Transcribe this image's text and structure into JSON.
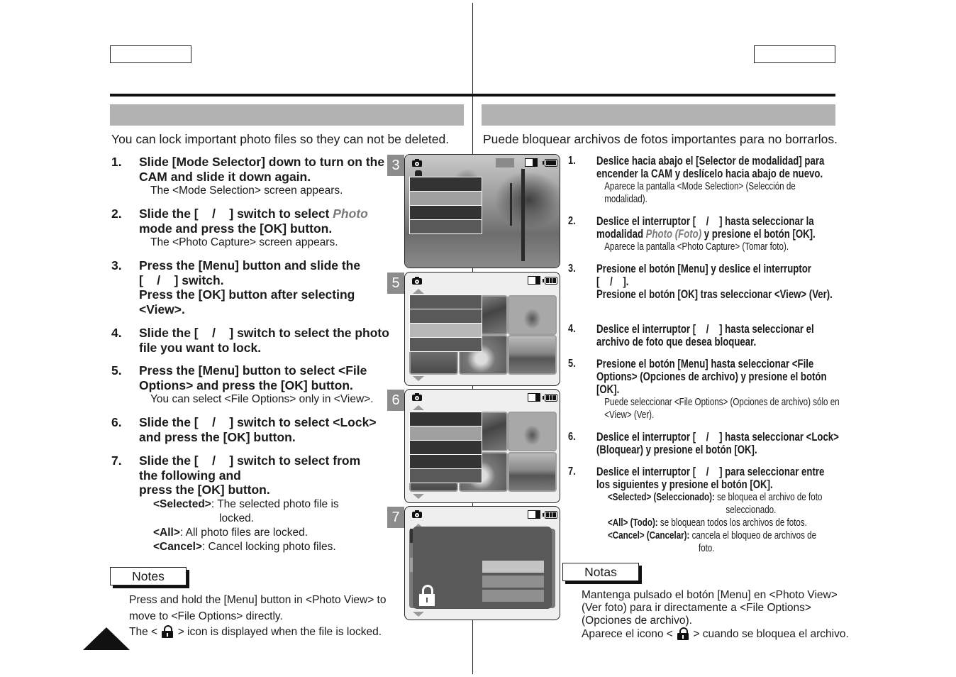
{
  "header": {
    "left_lang_box": "",
    "right_lang_box": ""
  },
  "english": {
    "title": "",
    "intro": "You can lock important photo files so they can not be deleted.",
    "steps": [
      {
        "num": "1.",
        "text": "Slide [Mode Selector] down to turn on the CAM and slide it down again.",
        "sub": "The <Mode Selection> screen appears."
      },
      {
        "num": "2.",
        "text_pre": "Slide the [    /    ] switch to select ",
        "text_em": "Photo",
        "text_post": " mode and press the [OK] button.",
        "sub": "The <Photo Capture> screen appears."
      },
      {
        "num": "3.",
        "line1": "Press the [Menu] button and slide the",
        "line2": "[    /    ] switch.",
        "line3": "Press the [OK] button after selecting <View>."
      },
      {
        "num": "4.",
        "text": "Slide the [    /    ] switch to select the photo file you want to lock."
      },
      {
        "num": "5.",
        "text": "Press the [Menu] button to select <File Options> and press the [OK] button.",
        "sub": "You can select <File Options> only in <View>."
      },
      {
        "num": "6.",
        "text": "Slide the [    /    ] switch to select <Lock> and press the [OK] button."
      },
      {
        "num": "7.",
        "line1": "Slide the [    /    ] switch to select from",
        "line2": "the following and",
        "line3": "press the [OK] button.",
        "options": [
          {
            "key": "<Selected>",
            "desc": ": The selected photo file is",
            "desc2": "locked."
          },
          {
            "key": "<All>",
            "desc": ": All photo files are locked."
          },
          {
            "key": "<Cancel>",
            "desc": ": Cancel locking photo files."
          }
        ]
      }
    ],
    "notes_label": "Notes",
    "notes": [
      "Press and hold the [Menu] button in <Photo View> to",
      "move to <File Options> directly."
    ],
    "notes_lock_pre": "The <",
    "notes_lock_post": "> icon is displayed when the file is locked."
  },
  "spanish": {
    "title": "",
    "intro": "Puede bloquear archivos de fotos importantes para no borrarlos.",
    "steps": [
      {
        "num": "1.",
        "text": "Deslice hacia abajo el [Selector de modalidad] para encender la CAM y deslícelo hacia abajo de nuevo.",
        "sub": "Aparece la pantalla <Mode Selection> (Selección de modalidad)."
      },
      {
        "num": "2.",
        "text_pre": "Deslice el interruptor [    /    ] hasta seleccionar la modalidad ",
        "text_em": "Photo (Foto)",
        "text_post": " y presione el botón [OK].",
        "sub": "Aparece la pantalla <Photo Capture> (Tomar foto)."
      },
      {
        "num": "3.",
        "line1": "Presione el botón [Menu] y deslice el interruptor",
        "line2": "[    /    ].",
        "line3": "Presione el botón [OK] tras seleccionar <View> (Ver)."
      },
      {
        "num": "4.",
        "text": "Deslice el interruptor [    /    ] hasta seleccionar el archivo de foto que desea bloquear."
      },
      {
        "num": "5.",
        "text": "Presione el botón [Menu] hasta seleccionar <File Options> (Opciones de archivo) y presione el botón [OK].",
        "sub": "Puede seleccionar <File Options> (Opciones de archivo) sólo en <View> (Ver)."
      },
      {
        "num": "6.",
        "text": "Deslice el interruptor [    /    ] hasta seleccionar <Lock> (Bloquear) y presione el botón [OK]."
      },
      {
        "num": "7.",
        "text": "Deslice el interruptor [    /    ] para seleccionar entre los siguientes y presione el botón [OK].",
        "options": [
          {
            "key": "<Selected> (Seleccionado):",
            "desc": " se bloquea el archivo de foto",
            "desc2": "seleccionado."
          },
          {
            "key": "<All> (Todo):",
            "desc": " se bloquean todos los archivos de fotos."
          },
          {
            "key": "<Cancel> (Cancelar):",
            "desc": " cancela el bloqueo de archivos de",
            "desc2": "foto."
          }
        ]
      }
    ],
    "notes_label": "Notas",
    "notes": [
      "Mantenga pulsado el botón [Menu] en <Photo View>",
      "(Ver foto) para ir directamente a <File Options>",
      "(Opciones de archivo)."
    ],
    "notes_lock_pre": "Aparece el icono <",
    "notes_lock_post": "> cuando se bloquea el archivo."
  },
  "screens": [
    {
      "step": "3",
      "icons": [
        "camera-icon",
        "stabilizer-icon",
        "memory-icon",
        "battery-icon"
      ]
    },
    {
      "step": "5",
      "icons": [
        "camera-icon",
        "memory-icon",
        "battery-icon"
      ]
    },
    {
      "step": "6",
      "icons": [
        "camera-icon",
        "memory-icon",
        "battery-icon"
      ]
    },
    {
      "step": "7",
      "icons": [
        "camera-icon",
        "memory-icon",
        "battery-icon",
        "lock-icon"
      ]
    }
  ],
  "colors": {
    "title_bar": "#b2b2b2",
    "step_badge": "#8c8c8c",
    "menu_dark": "#333333",
    "menu_mid": "#595959",
    "menu_light": "#a0a0a0",
    "emphasis_grey": "#7a7a7a"
  }
}
